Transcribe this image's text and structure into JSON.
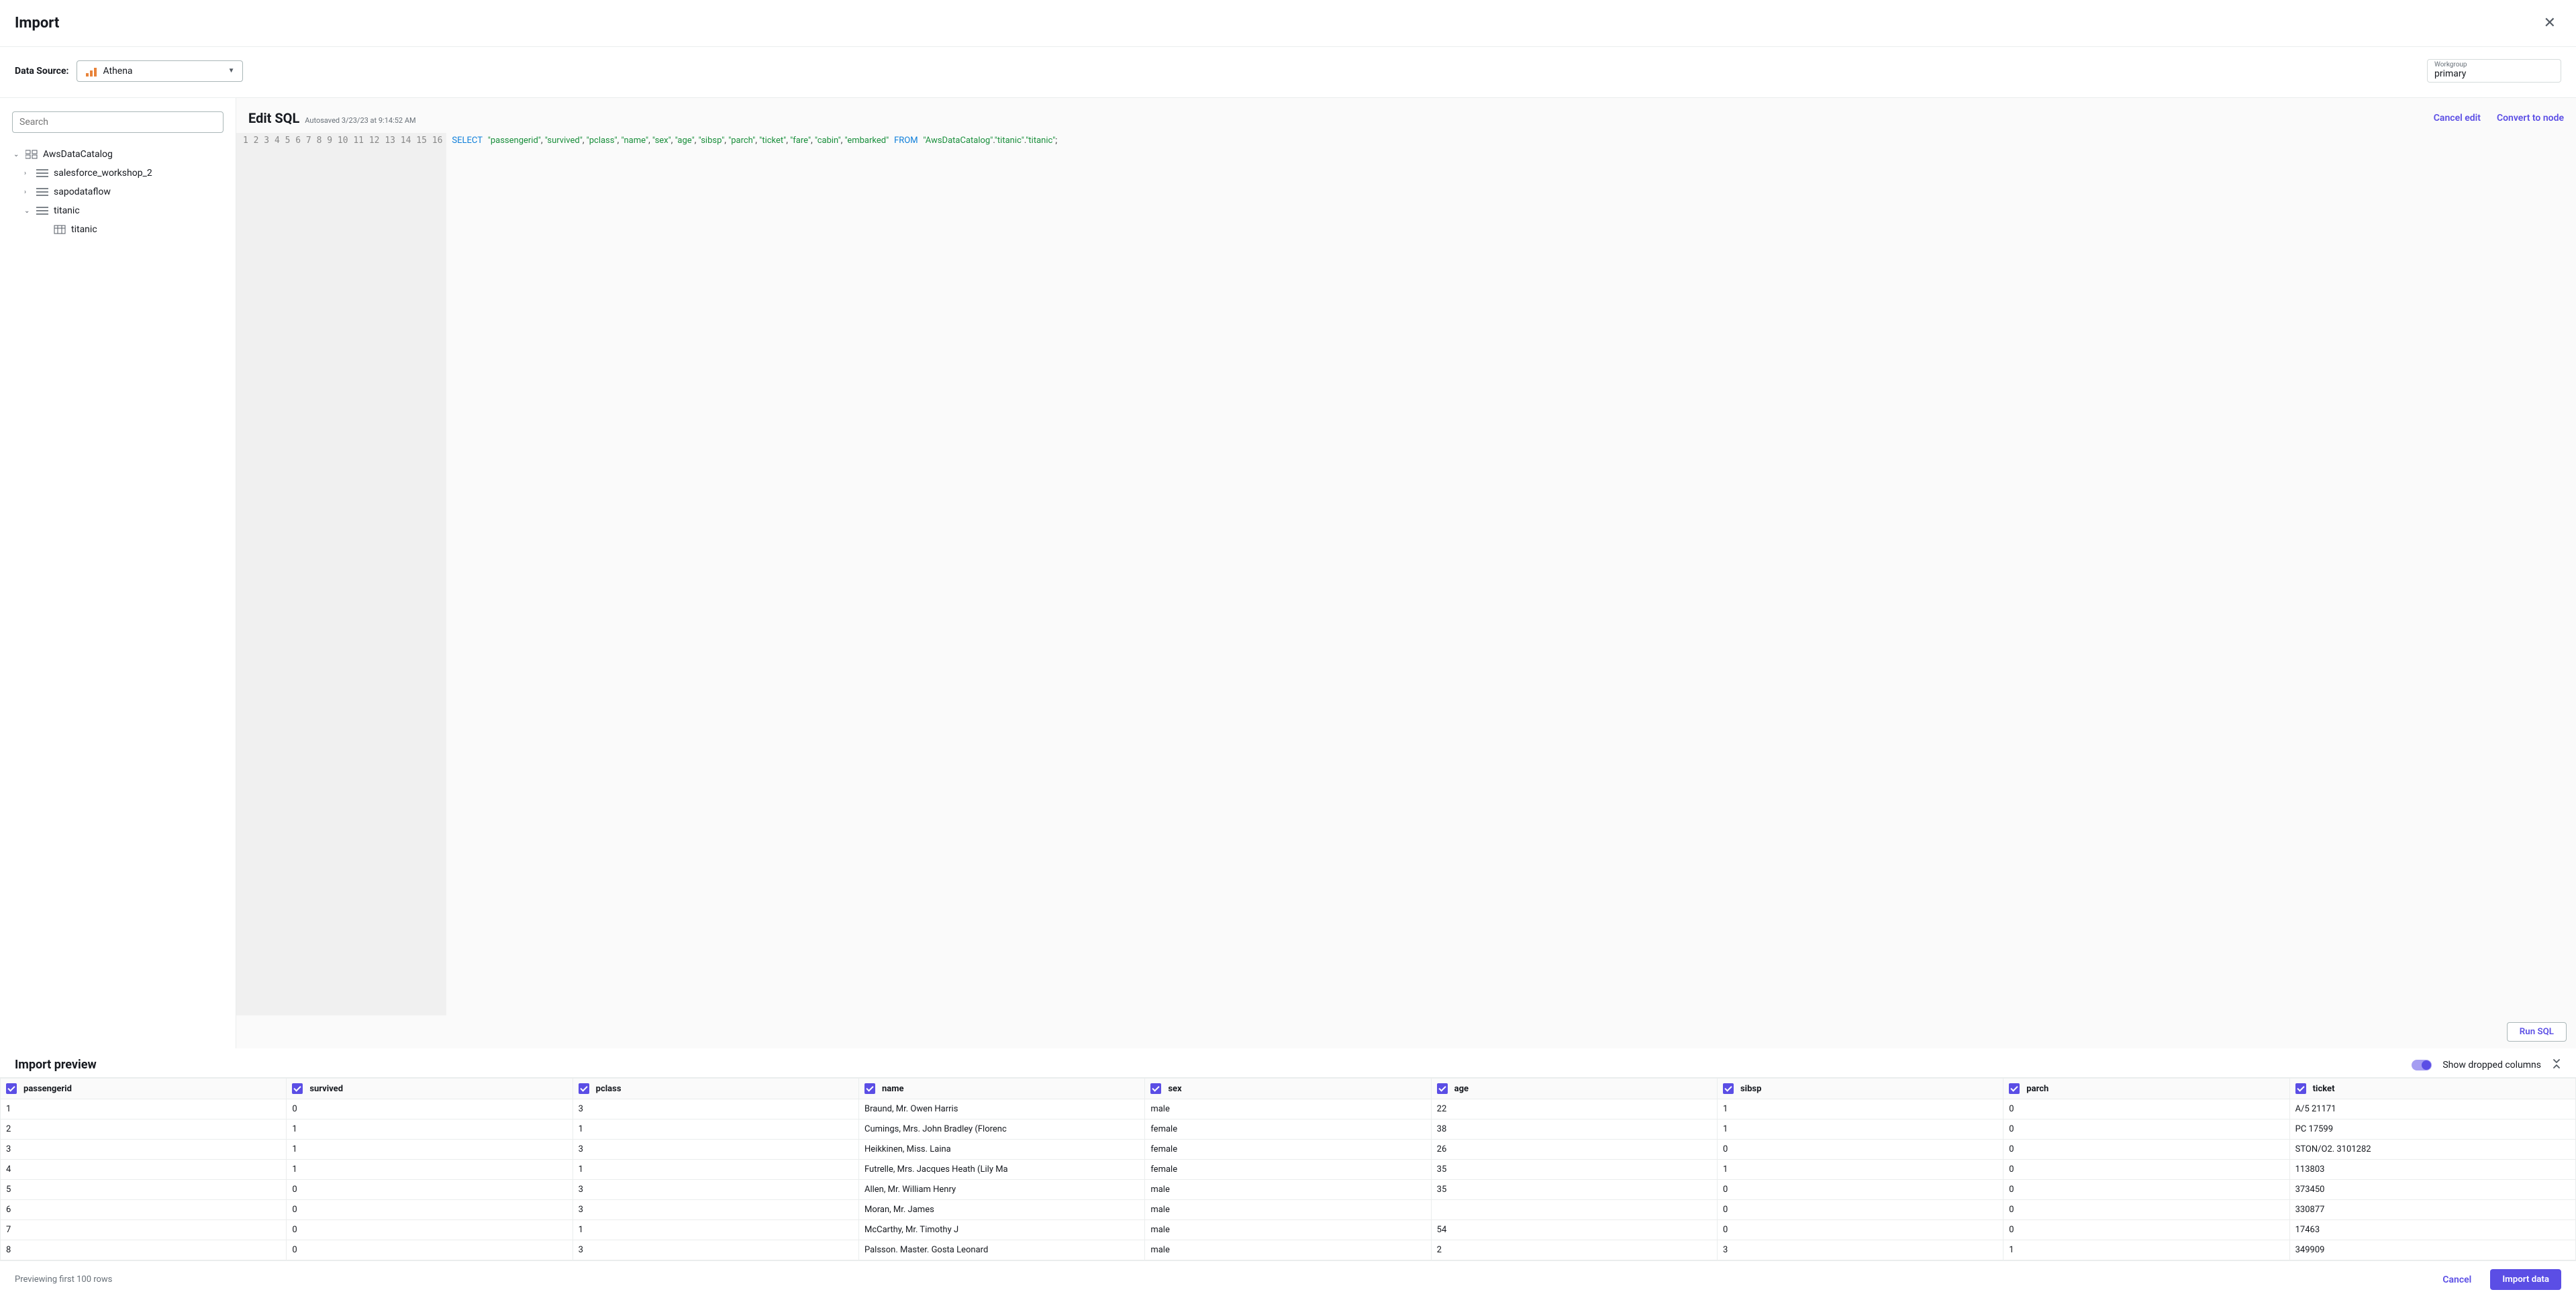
{
  "header": {
    "title": "Import"
  },
  "config": {
    "ds_label": "Data Source:",
    "ds_value": "Athena",
    "wg_label": "Workgroup",
    "wg_value": "primary"
  },
  "sidebar": {
    "search_placeholder": "Search",
    "tree": [
      {
        "name": "AwsDataCatalog",
        "expanded": true,
        "type": "catalog",
        "level": 0
      },
      {
        "name": "salesforce_workshop_2",
        "expanded": false,
        "type": "database",
        "level": 1
      },
      {
        "name": "sapodataflow",
        "expanded": false,
        "type": "database",
        "level": 1
      },
      {
        "name": "titanic",
        "expanded": true,
        "type": "database",
        "level": 1
      },
      {
        "name": "titanic",
        "expanded": null,
        "type": "table",
        "level": 2
      }
    ]
  },
  "editor": {
    "title": "Edit SQL",
    "autosave": "Autosaved 3/23/23 at 9:14:52 AM",
    "cancel_edit": "Cancel edit",
    "convert": "Convert to node",
    "run": "Run SQL",
    "sql_tokens": [
      {
        "t": "kw",
        "v": "SELECT"
      },
      {
        "t": "sp"
      },
      {
        "t": "str",
        "v": "\"passengerid\""
      },
      {
        "t": "punc",
        "v": ", "
      },
      {
        "t": "str",
        "v": "\"survived\""
      },
      {
        "t": "punc",
        "v": ", "
      },
      {
        "t": "str",
        "v": "\"pclass\""
      },
      {
        "t": "punc",
        "v": ", "
      },
      {
        "t": "str",
        "v": "\"name\""
      },
      {
        "t": "punc",
        "v": ", "
      },
      {
        "t": "str",
        "v": "\"sex\""
      },
      {
        "t": "punc",
        "v": ", "
      },
      {
        "t": "str",
        "v": "\"age\""
      },
      {
        "t": "punc",
        "v": ", "
      },
      {
        "t": "str",
        "v": "\"sibsp\""
      },
      {
        "t": "punc",
        "v": ", "
      },
      {
        "t": "str",
        "v": "\"parch\""
      },
      {
        "t": "punc",
        "v": ", "
      },
      {
        "t": "str",
        "v": "\"ticket\""
      },
      {
        "t": "punc",
        "v": ", "
      },
      {
        "t": "str",
        "v": "\"fare\""
      },
      {
        "t": "punc",
        "v": ", "
      },
      {
        "t": "str",
        "v": "\"cabin\""
      },
      {
        "t": "punc",
        "v": ", "
      },
      {
        "t": "str",
        "v": "\"embarked\""
      },
      {
        "t": "sp"
      },
      {
        "t": "kw",
        "v": "FROM"
      },
      {
        "t": "sp"
      },
      {
        "t": "str",
        "v": "\"AwsDataCatalog\""
      },
      {
        "t": "punc",
        "v": "."
      },
      {
        "t": "str",
        "v": "\"titanic\""
      },
      {
        "t": "punc",
        "v": "."
      },
      {
        "t": "str",
        "v": "\"titanic\""
      },
      {
        "t": "punc",
        "v": ";"
      }
    ],
    "line_count": 16
  },
  "preview": {
    "title": "Import preview",
    "toggle_label": "Show dropped columns",
    "columns": [
      "passengerid",
      "survived",
      "pclass",
      "name",
      "sex",
      "age",
      "sibsp",
      "parch",
      "ticket"
    ],
    "rows": [
      [
        "1",
        "0",
        "3",
        "Braund, Mr. Owen Harris",
        "male",
        "22",
        "1",
        "0",
        "A/5 21171"
      ],
      [
        "2",
        "1",
        "1",
        "Cumings, Mrs. John Bradley (Florenc",
        "female",
        "38",
        "1",
        "0",
        "PC 17599"
      ],
      [
        "3",
        "1",
        "3",
        "Heikkinen, Miss. Laina",
        "female",
        "26",
        "0",
        "0",
        "STON/O2. 3101282"
      ],
      [
        "4",
        "1",
        "1",
        "Futrelle, Mrs. Jacques Heath (Lily Ma",
        "female",
        "35",
        "1",
        "0",
        "113803"
      ],
      [
        "5",
        "0",
        "3",
        "Allen, Mr. William Henry",
        "male",
        "35",
        "0",
        "0",
        "373450"
      ],
      [
        "6",
        "0",
        "3",
        "Moran, Mr. James",
        "male",
        "",
        "0",
        "0",
        "330877"
      ],
      [
        "7",
        "0",
        "1",
        "McCarthy, Mr. Timothy J",
        "male",
        "54",
        "0",
        "0",
        "17463"
      ],
      [
        "8",
        "0",
        "3",
        "Palsson. Master. Gosta Leonard",
        "male",
        "2",
        "3",
        "1",
        "349909"
      ]
    ]
  },
  "footer": {
    "previewing": "Previewing first 100 rows",
    "cancel": "Cancel",
    "import": "Import data"
  }
}
